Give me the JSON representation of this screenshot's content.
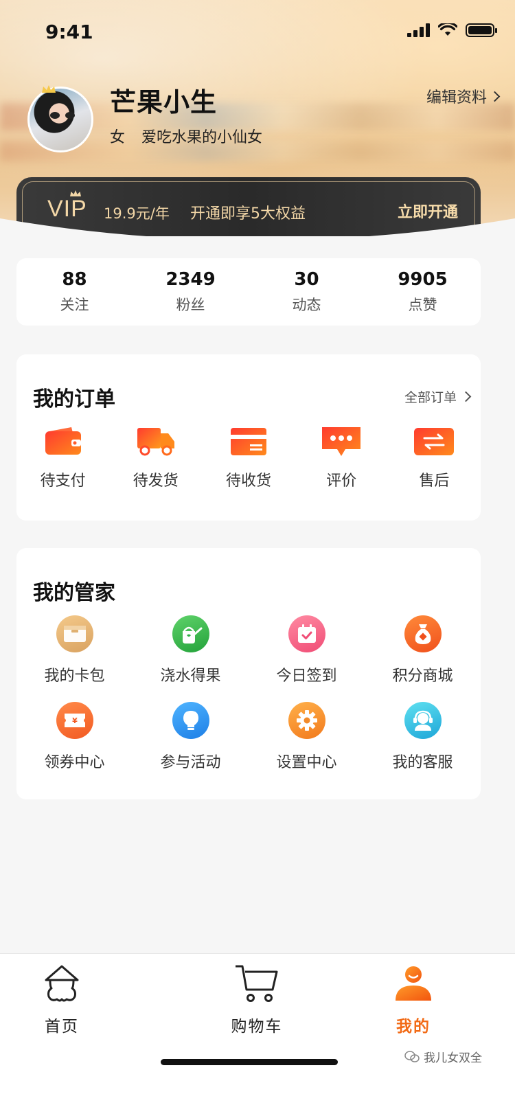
{
  "status_bar": {
    "time": "9:41"
  },
  "profile": {
    "name": "芒果小生",
    "gender": "女",
    "bio": "爱吃水果的小仙女",
    "edit_label": "编辑资料"
  },
  "vip": {
    "logo": "VIP",
    "price": "19.9元/年",
    "benefit": "开通即享5大权益",
    "action": "立即开通"
  },
  "stats": [
    {
      "value": "88",
      "label": "关注"
    },
    {
      "value": "2349",
      "label": "粉丝"
    },
    {
      "value": "30",
      "label": "动态"
    },
    {
      "value": "9905",
      "label": "点赞"
    }
  ],
  "orders": {
    "title": "我的订单",
    "all_label": "全部订单",
    "items": [
      {
        "label": "待支付",
        "icon": "wallet-icon"
      },
      {
        "label": "待发货",
        "icon": "truck-icon"
      },
      {
        "label": "待收货",
        "icon": "card-icon"
      },
      {
        "label": "评价",
        "icon": "comment-icon"
      },
      {
        "label": "售后",
        "icon": "exchange-icon"
      }
    ]
  },
  "butler": {
    "title": "我的管家",
    "items": [
      {
        "label": "我的卡包",
        "icon": "card-bag-icon"
      },
      {
        "label": "浇水得果",
        "icon": "watering-can-icon"
      },
      {
        "label": "今日签到",
        "icon": "calendar-check-icon"
      },
      {
        "label": "积分商城",
        "icon": "points-bag-icon"
      },
      {
        "label": "领券中心",
        "icon": "coupon-icon"
      },
      {
        "label": "参与活动",
        "icon": "lightbulb-icon"
      },
      {
        "label": "设置中心",
        "icon": "gear-icon"
      },
      {
        "label": "我的客服",
        "icon": "customer-service-icon"
      }
    ]
  },
  "tabbar": [
    {
      "label": "首页",
      "icon": "home-icon",
      "active": false
    },
    {
      "label": "购物车",
      "icon": "cart-icon",
      "active": false
    },
    {
      "label": "我的",
      "icon": "profile-icon",
      "active": true
    }
  ],
  "watermark": "我儿女双全",
  "colors": {
    "accent": "#f26a15",
    "vip_gold": "#f3d7a7",
    "vip_bg": "#2f2f2f"
  }
}
